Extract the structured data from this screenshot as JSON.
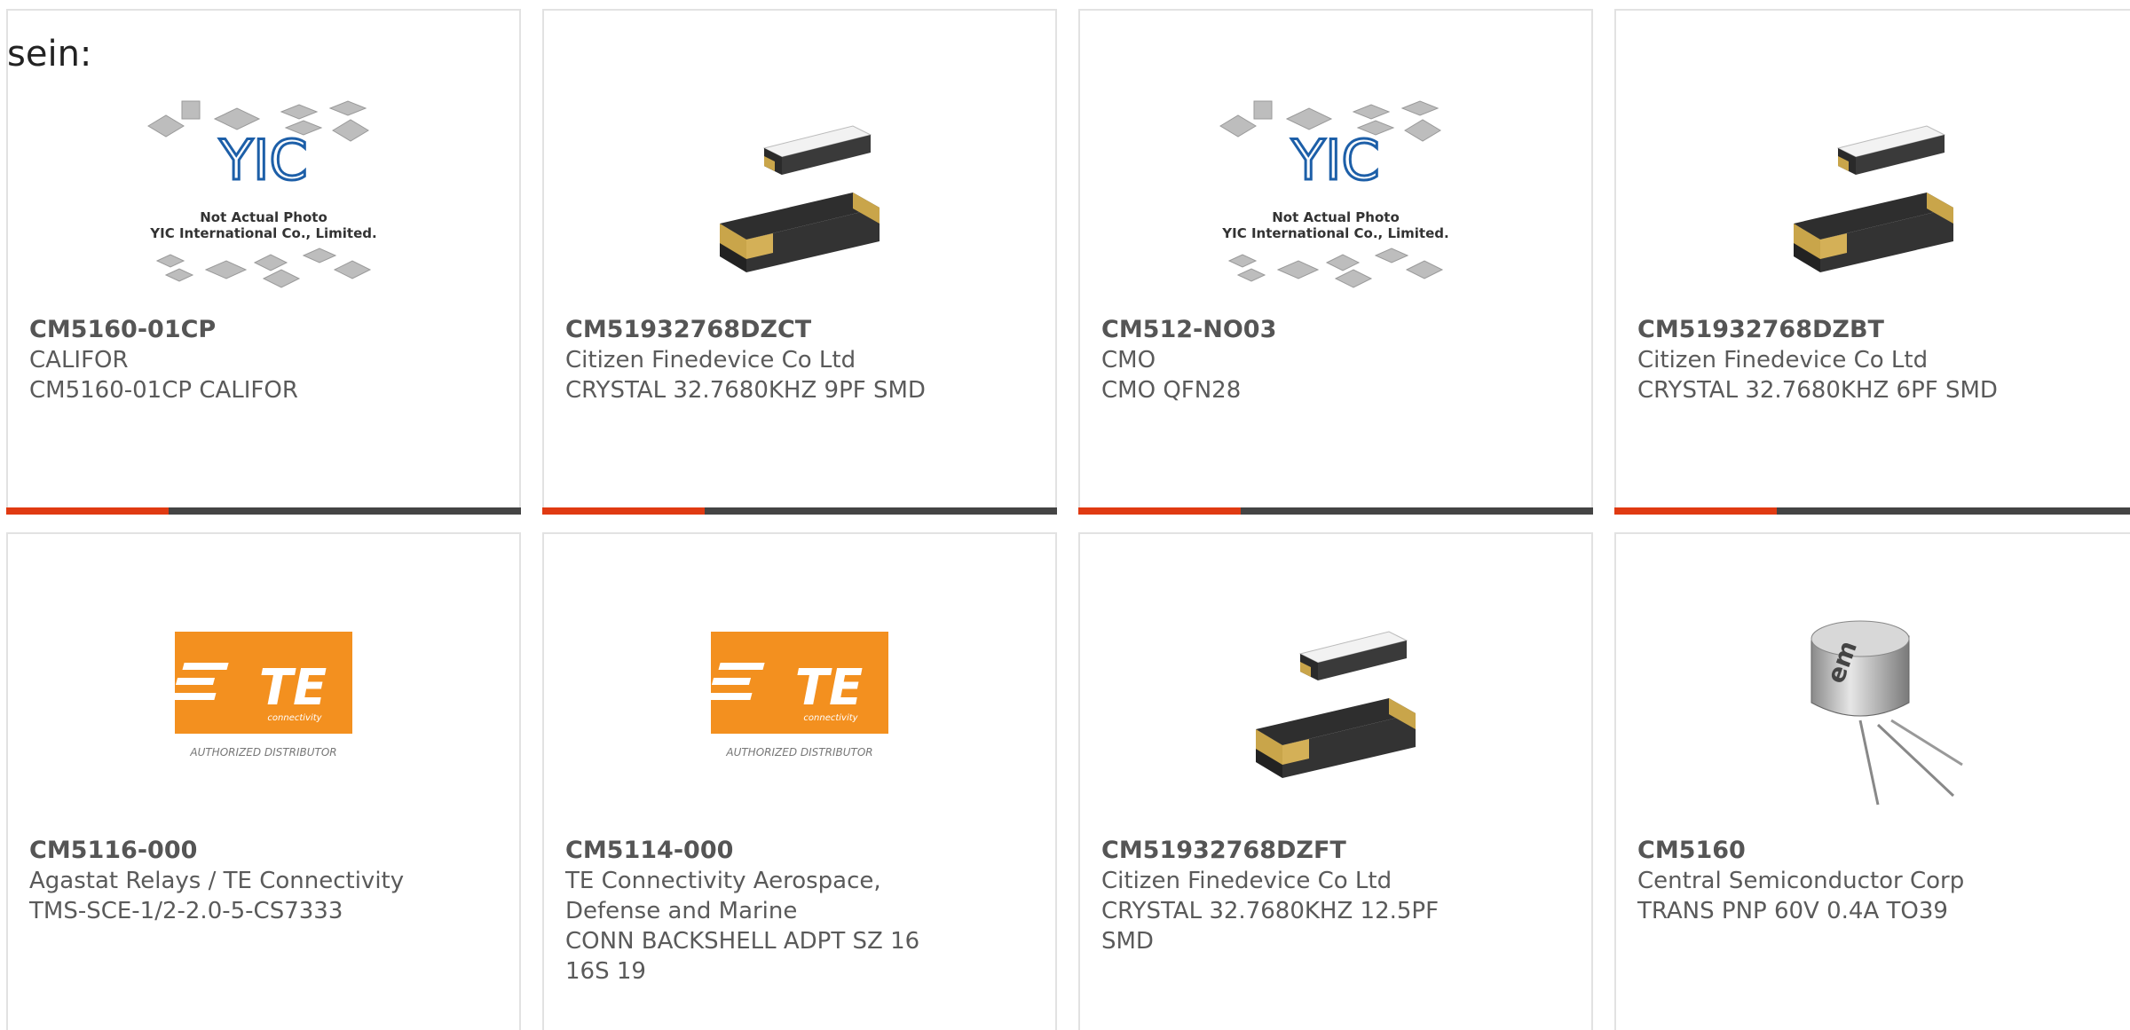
{
  "intro_text": "sein:",
  "colors": {
    "accent": "#e03a12",
    "bar": "#444444",
    "border": "#e2e2e2",
    "te_orange": "#f3901f"
  },
  "cards": [
    {
      "part": "CM5160-01CP",
      "maker": "CALIFOR",
      "desc": "CM5160-01CP CALIFOR",
      "image": "yic-placeholder",
      "img_text1": "Not Actual Photo",
      "img_text2": "YIC International Co., Limited.",
      "logo": "YIC"
    },
    {
      "part": "CM51932768DZCT",
      "maker": "Citizen Finedevice Co Ltd",
      "desc": "CRYSTAL 32.7680KHZ 9PF SMD",
      "image": "crystal-smd"
    },
    {
      "part": "CM512-NO03",
      "maker": "CMO",
      "desc": "CMO QFN28",
      "image": "yic-placeholder",
      "img_text1": "Not Actual Photo",
      "img_text2": "YIC International Co., Limited.",
      "logo": "YIC"
    },
    {
      "part": "CM51932768DZBT",
      "maker": "Citizen Finedevice Co Ltd",
      "desc": "CRYSTAL 32.7680KHZ 6PF SMD",
      "image": "crystal-smd"
    },
    {
      "part": "CM5116-000",
      "maker": "Agastat Relays / TE Connectivity",
      "desc": "TMS-SCE-1/2-2.0-5-CS7333",
      "image": "te-logo",
      "logo_text": "TE",
      "logo_sub": "connectivity",
      "logo_caption": "AUTHORIZED DISTRIBUTOR"
    },
    {
      "part": "CM5114-000",
      "maker": "TE Connectivity Aerospace, Defense and Marine",
      "desc": "CONN BACKSHELL ADPT SZ 16 16S 19",
      "image": "te-logo",
      "logo_text": "TE",
      "logo_sub": "connectivity",
      "logo_caption": "AUTHORIZED DISTRIBUTOR"
    },
    {
      "part": "CM51932768DZFT",
      "maker": "Citizen Finedevice Co Ltd",
      "desc": "CRYSTAL 32.7680KHZ 12.5PF SMD",
      "image": "crystal-smd"
    },
    {
      "part": "CM5160",
      "maker": "Central Semiconductor Corp",
      "desc": "TRANS PNP 60V 0.4A TO39",
      "image": "to39-transistor",
      "logo_text": "em"
    }
  ]
}
